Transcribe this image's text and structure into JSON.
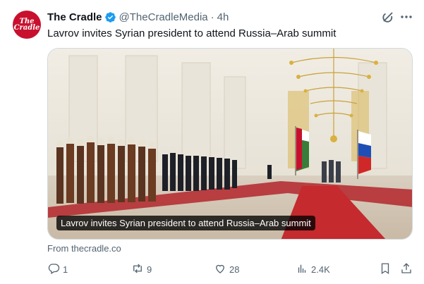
{
  "tweet": {
    "avatar_text": "The Cradle",
    "author_name": "The Cradle",
    "handle": "@TheCradleMedia",
    "separator": "·",
    "time": "4h",
    "text": "Lavrov invites Syrian president to attend Russia–Arab summit",
    "card": {
      "caption": "Lavrov invites Syrian president to attend Russia–Arab summit",
      "source": "From thecradle.co"
    },
    "actions": {
      "replies": "1",
      "reposts": "9",
      "likes": "28",
      "views": "2.4K"
    }
  },
  "colors": {
    "accent": "#1d9bf0",
    "secondary_text": "#536471",
    "avatar_bg": "#c8102e"
  },
  "icons": [
    "verified-badge-icon",
    "grok-icon",
    "more-icon",
    "reply-icon",
    "repost-icon",
    "like-icon",
    "views-icon",
    "bookmark-icon",
    "share-icon"
  ]
}
